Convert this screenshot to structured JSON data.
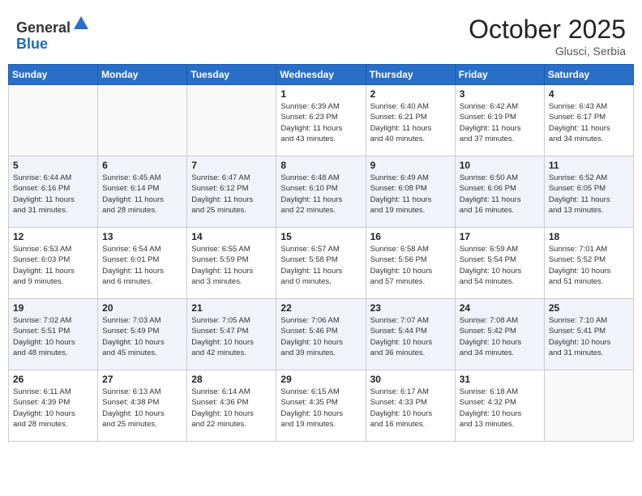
{
  "header": {
    "logo_line1": "General",
    "logo_line2": "Blue",
    "month_title": "October 2025",
    "location": "Glusci, Serbia"
  },
  "weekdays": [
    "Sunday",
    "Monday",
    "Tuesday",
    "Wednesday",
    "Thursday",
    "Friday",
    "Saturday"
  ],
  "weeks": [
    [
      {
        "day": "",
        "info": ""
      },
      {
        "day": "",
        "info": ""
      },
      {
        "day": "",
        "info": ""
      },
      {
        "day": "1",
        "info": "Sunrise: 6:39 AM\nSunset: 6:23 PM\nDaylight: 11 hours\nand 43 minutes."
      },
      {
        "day": "2",
        "info": "Sunrise: 6:40 AM\nSunset: 6:21 PM\nDaylight: 11 hours\nand 40 minutes."
      },
      {
        "day": "3",
        "info": "Sunrise: 6:42 AM\nSunset: 6:19 PM\nDaylight: 11 hours\nand 37 minutes."
      },
      {
        "day": "4",
        "info": "Sunrise: 6:43 AM\nSunset: 6:17 PM\nDaylight: 11 hours\nand 34 minutes."
      }
    ],
    [
      {
        "day": "5",
        "info": "Sunrise: 6:44 AM\nSunset: 6:16 PM\nDaylight: 11 hours\nand 31 minutes."
      },
      {
        "day": "6",
        "info": "Sunrise: 6:45 AM\nSunset: 6:14 PM\nDaylight: 11 hours\nand 28 minutes."
      },
      {
        "day": "7",
        "info": "Sunrise: 6:47 AM\nSunset: 6:12 PM\nDaylight: 11 hours\nand 25 minutes."
      },
      {
        "day": "8",
        "info": "Sunrise: 6:48 AM\nSunset: 6:10 PM\nDaylight: 11 hours\nand 22 minutes."
      },
      {
        "day": "9",
        "info": "Sunrise: 6:49 AM\nSunset: 6:08 PM\nDaylight: 11 hours\nand 19 minutes."
      },
      {
        "day": "10",
        "info": "Sunrise: 6:50 AM\nSunset: 6:06 PM\nDaylight: 11 hours\nand 16 minutes."
      },
      {
        "day": "11",
        "info": "Sunrise: 6:52 AM\nSunset: 6:05 PM\nDaylight: 11 hours\nand 13 minutes."
      }
    ],
    [
      {
        "day": "12",
        "info": "Sunrise: 6:53 AM\nSunset: 6:03 PM\nDaylight: 11 hours\nand 9 minutes."
      },
      {
        "day": "13",
        "info": "Sunrise: 6:54 AM\nSunset: 6:01 PM\nDaylight: 11 hours\nand 6 minutes."
      },
      {
        "day": "14",
        "info": "Sunrise: 6:55 AM\nSunset: 5:59 PM\nDaylight: 11 hours\nand 3 minutes."
      },
      {
        "day": "15",
        "info": "Sunrise: 6:57 AM\nSunset: 5:58 PM\nDaylight: 11 hours\nand 0 minutes."
      },
      {
        "day": "16",
        "info": "Sunrise: 6:58 AM\nSunset: 5:56 PM\nDaylight: 10 hours\nand 57 minutes."
      },
      {
        "day": "17",
        "info": "Sunrise: 6:59 AM\nSunset: 5:54 PM\nDaylight: 10 hours\nand 54 minutes."
      },
      {
        "day": "18",
        "info": "Sunrise: 7:01 AM\nSunset: 5:52 PM\nDaylight: 10 hours\nand 51 minutes."
      }
    ],
    [
      {
        "day": "19",
        "info": "Sunrise: 7:02 AM\nSunset: 5:51 PM\nDaylight: 10 hours\nand 48 minutes."
      },
      {
        "day": "20",
        "info": "Sunrise: 7:03 AM\nSunset: 5:49 PM\nDaylight: 10 hours\nand 45 minutes."
      },
      {
        "day": "21",
        "info": "Sunrise: 7:05 AM\nSunset: 5:47 PM\nDaylight: 10 hours\nand 42 minutes."
      },
      {
        "day": "22",
        "info": "Sunrise: 7:06 AM\nSunset: 5:46 PM\nDaylight: 10 hours\nand 39 minutes."
      },
      {
        "day": "23",
        "info": "Sunrise: 7:07 AM\nSunset: 5:44 PM\nDaylight: 10 hours\nand 36 minutes."
      },
      {
        "day": "24",
        "info": "Sunrise: 7:08 AM\nSunset: 5:42 PM\nDaylight: 10 hours\nand 34 minutes."
      },
      {
        "day": "25",
        "info": "Sunrise: 7:10 AM\nSunset: 5:41 PM\nDaylight: 10 hours\nand 31 minutes."
      }
    ],
    [
      {
        "day": "26",
        "info": "Sunrise: 6:11 AM\nSunset: 4:39 PM\nDaylight: 10 hours\nand 28 minutes."
      },
      {
        "day": "27",
        "info": "Sunrise: 6:13 AM\nSunset: 4:38 PM\nDaylight: 10 hours\nand 25 minutes."
      },
      {
        "day": "28",
        "info": "Sunrise: 6:14 AM\nSunset: 4:36 PM\nDaylight: 10 hours\nand 22 minutes."
      },
      {
        "day": "29",
        "info": "Sunrise: 6:15 AM\nSunset: 4:35 PM\nDaylight: 10 hours\nand 19 minutes."
      },
      {
        "day": "30",
        "info": "Sunrise: 6:17 AM\nSunset: 4:33 PM\nDaylight: 10 hours\nand 16 minutes."
      },
      {
        "day": "31",
        "info": "Sunrise: 6:18 AM\nSunset: 4:32 PM\nDaylight: 10 hours\nand 13 minutes."
      },
      {
        "day": "",
        "info": ""
      }
    ]
  ]
}
